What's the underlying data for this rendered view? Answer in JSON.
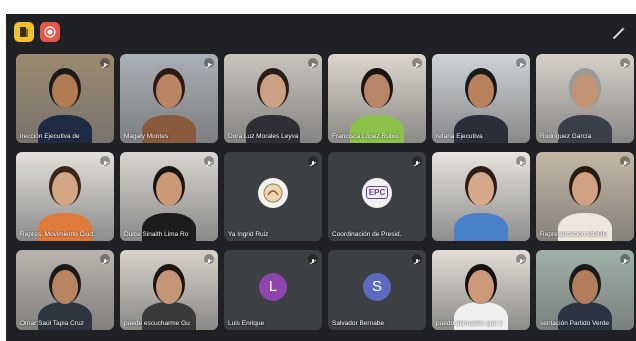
{
  "toolbar": {
    "info_icon": "meeting-info-icon",
    "record_icon": "recording-icon",
    "effects_icon": "visual-effects-icon",
    "colors": {
      "info": "#f2c12e",
      "record": "#e6564a"
    }
  },
  "participants": [
    {
      "name": "irección Ejecutiva de",
      "type": "video",
      "bg": "#9b8a6f",
      "skin": "#b07a55",
      "cloth": "#1f2a44",
      "hair": "#1a1a1a"
    },
    {
      "name": "Magaly Montes",
      "type": "video",
      "bg": "#a9b0b6",
      "skin": "#b98462",
      "cloth": "#8a5a3c",
      "hair": "#2a1a12"
    },
    {
      "name": "Dora Luz Morales Leyva",
      "type": "video",
      "bg": "#c8c3bd",
      "skin": "#caa184",
      "cloth": "#2f2f35",
      "hair": "#2a1d17"
    },
    {
      "name": "Francisca López Rubio",
      "type": "video",
      "bg": "#dcd6cc",
      "skin": "#b88566",
      "cloth": "#8cc24a",
      "hair": "#1a1310"
    },
    {
      "name": "retaria Ejecutiva",
      "type": "video",
      "bg": "#cfd3d6",
      "skin": "#b8805b",
      "cloth": "#2a2e38",
      "hair": "#1a1a1a"
    },
    {
      "name": "Rodríguez García",
      "type": "video",
      "bg": "#d6d0c9",
      "skin": "#c29474",
      "cloth": "#3a3f4a",
      "hair": "#9a9a9a"
    },
    {
      "name": "Repres. Movimiento Ciud.",
      "type": "video",
      "bg": "#e3e0db",
      "skin": "#d2a685",
      "cloth": "#e07a3c",
      "hair": "#3a2519"
    },
    {
      "name": "Dulce Sinaith Lima Ro",
      "type": "video",
      "bg": "#d9d5d0",
      "skin": "#c99978",
      "cloth": "#1c1c1c",
      "hair": "#1a1410"
    },
    {
      "name": "Ya Ingrid Ruiz",
      "type": "logo",
      "logo": "emblem"
    },
    {
      "name": "Coordinación de Presid.",
      "type": "logo",
      "logo": "EPC"
    },
    {
      "name": "",
      "type": "video",
      "bg": "#e8e4df",
      "skin": "#d4a98a",
      "cloth": "#4a80c8",
      "hair": "#2b1c14"
    },
    {
      "name": "Representación MORE",
      "type": "video",
      "bg": "#c4b7a4",
      "skin": "#cfa283",
      "cloth": "#ede6da",
      "hair": "#2a1b12"
    },
    {
      "name": "Omar Saúl Tapia Cruz",
      "type": "video",
      "bg": "#b9b4ad",
      "skin": "#b98462",
      "cloth": "#2f3540",
      "hair": "#1a1a1a"
    },
    {
      "name": "puede escucharme Gu",
      "type": "video",
      "bg": "#d8d2cb",
      "skin": "#c59577",
      "cloth": "#3a3a3a",
      "hair": "#1c1410"
    },
    {
      "name": "Luis Enrique",
      "type": "avatar",
      "initial": "L",
      "color": "#8e44ad"
    },
    {
      "name": "Salvador Bernabe",
      "type": "avatar",
      "initial": "S",
      "color": "#5c6bc0"
    },
    {
      "name": "puedo afirmarles que 1",
      "type": "video",
      "bg": "#e2ddd6",
      "skin": "#cc9a7a",
      "cloth": "#efefef",
      "hair": "#150f0c"
    },
    {
      "name": "sentación Partido Verde",
      "type": "video",
      "bg": "#9fb2a8",
      "skin": "#b17d5b",
      "cloth": "#2c3444",
      "hair": "#1a1a1a"
    }
  ]
}
